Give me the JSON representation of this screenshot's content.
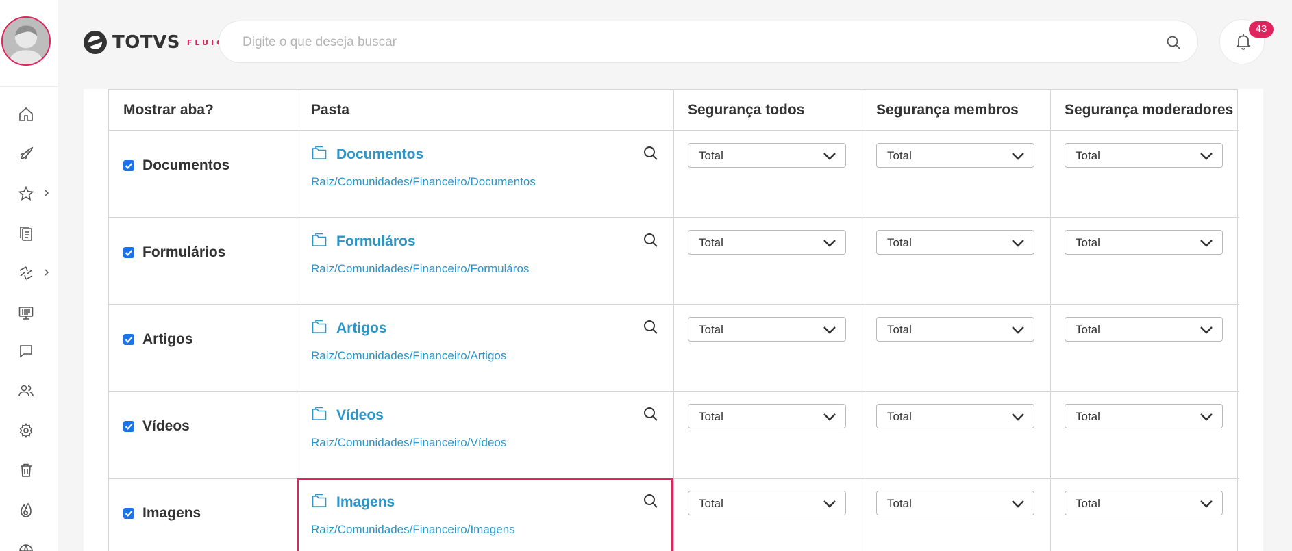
{
  "header": {
    "logo_text": "TOTVS",
    "logo_sub": "FLUIG",
    "search_placeholder": "Digite o que deseja buscar",
    "notification_count": "43"
  },
  "sidebar": {
    "items": [
      {
        "icon": "home-icon",
        "expandable": false
      },
      {
        "icon": "rocket-icon",
        "expandable": false
      },
      {
        "icon": "star-icon",
        "expandable": true
      },
      {
        "icon": "documents-icon",
        "expandable": false
      },
      {
        "icon": "workflow-icon",
        "expandable": true
      },
      {
        "icon": "presentation-icon",
        "expandable": false
      },
      {
        "icon": "chat-icon",
        "expandable": false
      },
      {
        "icon": "users-icon",
        "expandable": false
      },
      {
        "icon": "gear-icon",
        "expandable": false
      },
      {
        "icon": "trash-icon",
        "expandable": false
      },
      {
        "icon": "flame-icon",
        "expandable": false
      },
      {
        "icon": "globe-icon",
        "expandable": false
      }
    ]
  },
  "table": {
    "headers": {
      "tab": "Mostrar aba?",
      "folder": "Pasta",
      "sec_all": "Segurança todos",
      "sec_members": "Segurança membros",
      "sec_moderators": "Segurança moderadores"
    },
    "rows": [
      {
        "tab": "Documentos",
        "checked": true,
        "folder": "Documentos",
        "path": "Raiz/Comunidades/Financeiro/Documentos",
        "sec_all": "Total",
        "sec_members": "Total",
        "sec_moderators": "Total"
      },
      {
        "tab": "Formulários",
        "checked": true,
        "folder": "Formuláros",
        "path": "Raiz/Comunidades/Financeiro/Formuláros",
        "sec_all": "Total",
        "sec_members": "Total",
        "sec_moderators": "Total"
      },
      {
        "tab": "Artigos",
        "checked": true,
        "folder": "Artigos",
        "path": "Raiz/Comunidades/Financeiro/Artigos",
        "sec_all": "Total",
        "sec_members": "Total",
        "sec_moderators": "Total"
      },
      {
        "tab": "Vídeos",
        "checked": true,
        "folder": "Vídeos",
        "path": "Raiz/Comunidades/Financeiro/Vídeos",
        "sec_all": "Total",
        "sec_members": "Total",
        "sec_moderators": "Total"
      },
      {
        "tab": "Imagens",
        "checked": true,
        "folder": "Imagens",
        "path": "Raiz/Comunidades/Financeiro/Imagens",
        "sec_all": "Total",
        "sec_members": "Total",
        "sec_moderators": "Total",
        "highlighted": true
      }
    ]
  },
  "colors": {
    "accent": "#e0245e",
    "link": "#2a96c9",
    "checkbox": "#1a73e8"
  }
}
